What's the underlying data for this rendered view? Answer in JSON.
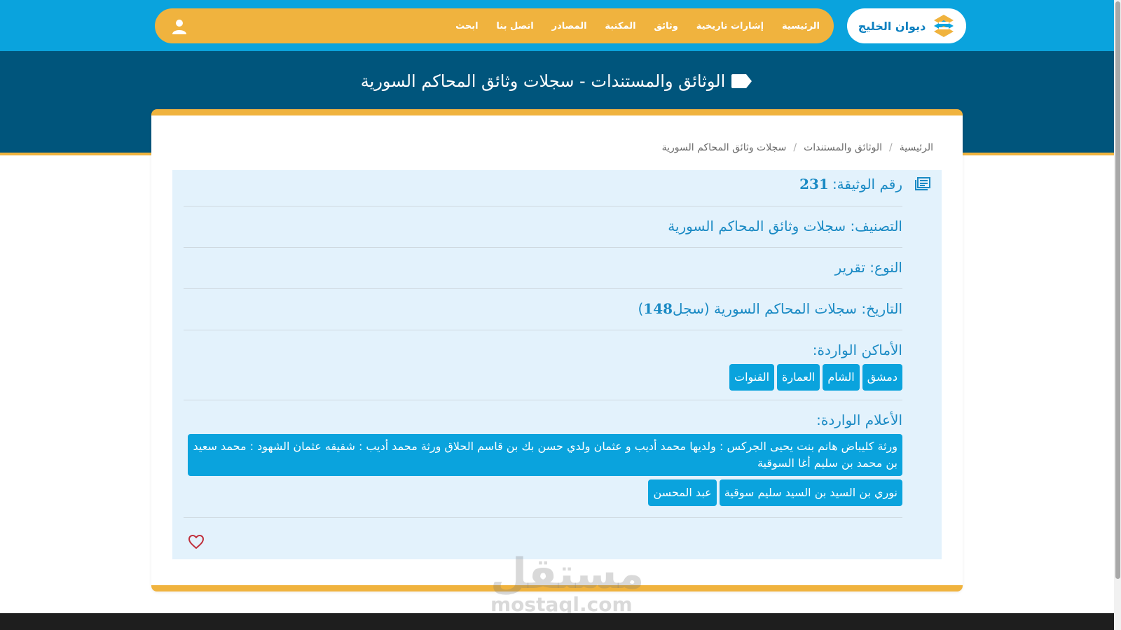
{
  "header": {
    "logo_text": "ديوان الخليج",
    "nav": [
      "الرئيسية",
      "إشارات تاريخية",
      "وثائق",
      "المكتبة",
      "المصادر",
      "اتصل بنا",
      "ابحث"
    ]
  },
  "hero": {
    "title": "الوثائق والمستندات - سجلات وثائق المحاكم السورية"
  },
  "breadcrumb": [
    "الرئيسية",
    "الوثائق والمستندات",
    "سجلات وثائق المحاكم السورية"
  ],
  "document": {
    "number_label": "رقم الوثيقة:",
    "number": "231",
    "classification": "التصنيف: سجلات وثائق المحاكم السورية",
    "type": "النوع: تقرير",
    "date_label": "التاريخ: سجلات المحاكم السورية (سجل",
    "date_num": "148",
    "date_close": ")",
    "places_label": "الأماكن الواردة:",
    "places": [
      "دمشق",
      "الشام",
      "العمارة",
      "القنوات"
    ],
    "people_label": "الأعلام الواردة:",
    "people_long": "ورثة كليباض هانم بنت يحيى الجركس : ولديها محمد أديب و عثمان ولدي حسن بك بن قاسم الحلاق ورثة محمد أديب : شقيقه عثمان الشهود : محمد سعيد بن محمد بن سليم أغا السوقية",
    "people": [
      "نوري بن السيد بن السيد سليم سوقية",
      "عبد المحسن"
    ]
  },
  "watermark": {
    "ar": "مستقل",
    "en": "mostaql.com"
  },
  "colors": {
    "topbar": "#0aa3dd",
    "nav_pill": "#f0b33e",
    "hero": "#00557c",
    "panel": "#e3f2fc",
    "tag": "#0aa3dd",
    "heart": "#c0303c"
  }
}
